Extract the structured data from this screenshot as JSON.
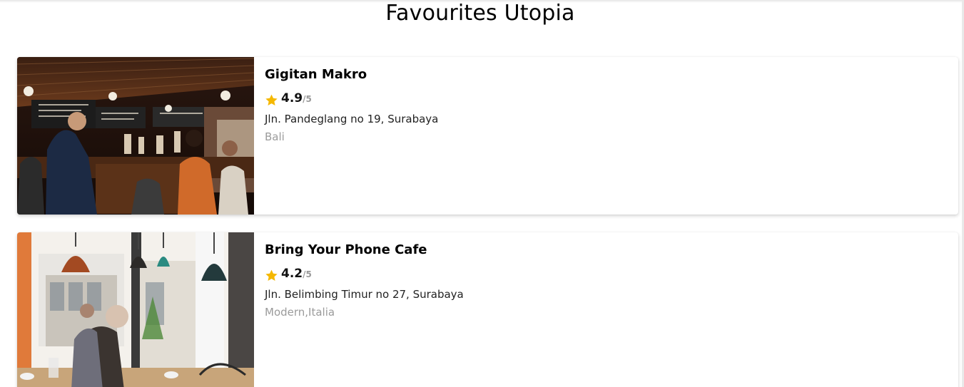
{
  "page": {
    "title": "Favourites Utopia"
  },
  "favourites": [
    {
      "name": "Gigitan Makro",
      "rating": "4.9",
      "rating_max": "/5",
      "address": "Jln. Pandeglang no 19, Surabaya",
      "category": "Bali",
      "image": "crowded-coffee-bar-photo"
    },
    {
      "name": "Bring Your Phone Cafe",
      "rating": "4.2",
      "rating_max": "/5",
      "address": "Jln. Belimbing Timur no 27, Surabaya",
      "category": "Modern,Italia",
      "image": "bright-cafe-interior-photo"
    }
  ],
  "colors": {
    "star": "#f5b800",
    "muted": "#9b9b9b"
  }
}
